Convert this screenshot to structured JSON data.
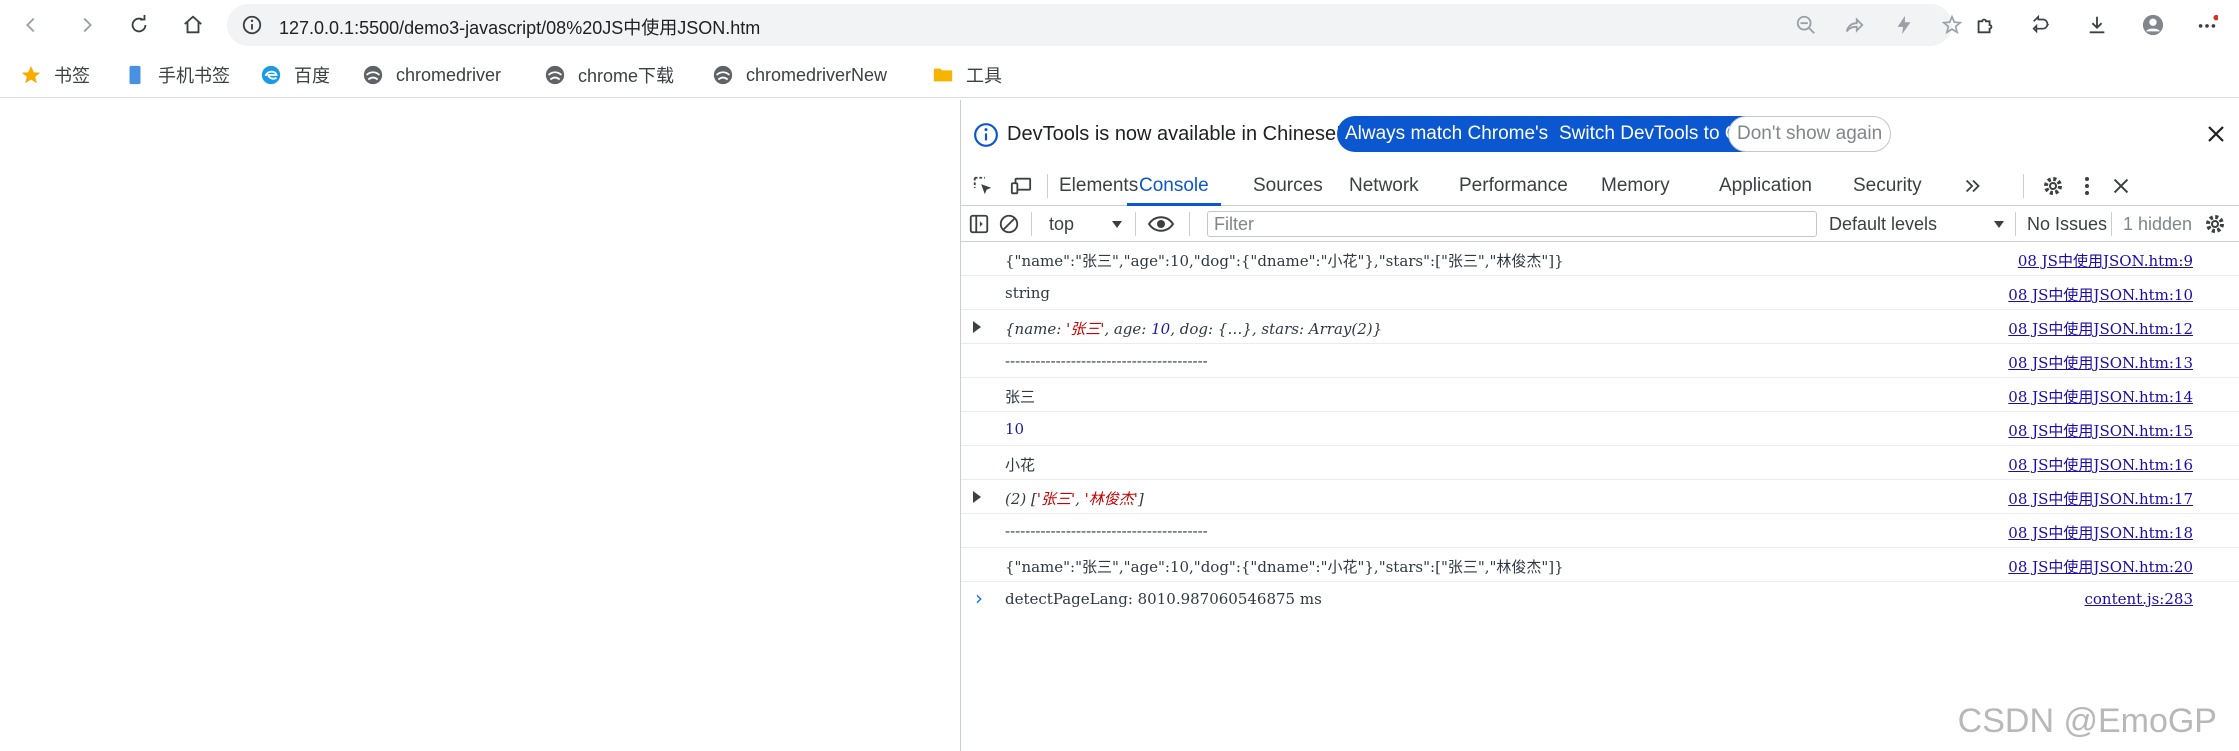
{
  "toolbar": {
    "url": "127.0.0.1:5500/demo3-javascript/08%20JS中使用JSON.htm"
  },
  "bookmarks": [
    {
      "label": "书签",
      "icon": "star-icon"
    },
    {
      "label": "手机书签",
      "icon": "phone-bookmark-icon"
    },
    {
      "label": "百度",
      "icon": "edge-icon"
    },
    {
      "label": "chromedriver",
      "icon": "globe-icon"
    },
    {
      "label": "chrome下载",
      "icon": "globe-icon"
    },
    {
      "label": "chromedriverNew",
      "icon": "globe-icon"
    },
    {
      "label": "工具",
      "icon": "folder-icon"
    }
  ],
  "devtools": {
    "infobar": {
      "message": "DevTools is now available in Chinese!",
      "btn_always": "Always match Chrome's language",
      "btn_switch": "Switch DevTools to Chinese",
      "btn_dont_show": "Don't show again"
    },
    "tabs": [
      "Elements",
      "Console",
      "Sources",
      "Network",
      "Performance",
      "Memory",
      "Application",
      "Security"
    ],
    "active_tab": "Console",
    "console_bar": {
      "context": "top",
      "filter_placeholder": "Filter",
      "levels": "Default levels",
      "issues": "No Issues",
      "hidden": "1 hidden"
    },
    "messages": [
      {
        "text": "{\"name\":\"张三\",\"age\":10,\"dog\":{\"dname\":\"小花\"},\"stars\":[\"张三\",\"林俊杰\"]}",
        "source": "08 JS中使用JSON.htm:9"
      },
      {
        "text": "string",
        "source": "08 JS中使用JSON.htm:10"
      },
      {
        "text": "{name: '张三', age: 10, dog: {…}, stars: Array(2)}",
        "source": "08 JS中使用JSON.htm:12",
        "expandable": true
      },
      {
        "text": "----------------------------------------",
        "source": "08 JS中使用JSON.htm:13"
      },
      {
        "text": "张三",
        "source": "08 JS中使用JSON.htm:14"
      },
      {
        "text": "10",
        "source": "08 JS中使用JSON.htm:15"
      },
      {
        "text": "小花",
        "source": "08 JS中使用JSON.htm:16"
      },
      {
        "text": "(2) ['张三', '林俊杰']",
        "source": "08 JS中使用JSON.htm:17",
        "expandable": true
      },
      {
        "text": "----------------------------------------",
        "source": "08 JS中使用JSON.htm:18"
      },
      {
        "text": "{\"name\":\"张三\",\"age\":10,\"dog\":{\"dname\":\"小花\"},\"stars\":[\"张三\",\"林俊杰\"]}",
        "source": "08 JS中使用JSON.htm:20"
      },
      {
        "text": "detectPageLang: 8010.987060546875 ms",
        "source": "content.js:283"
      }
    ],
    "prompt": "›"
  },
  "watermark": "CSDN @EmoGP"
}
